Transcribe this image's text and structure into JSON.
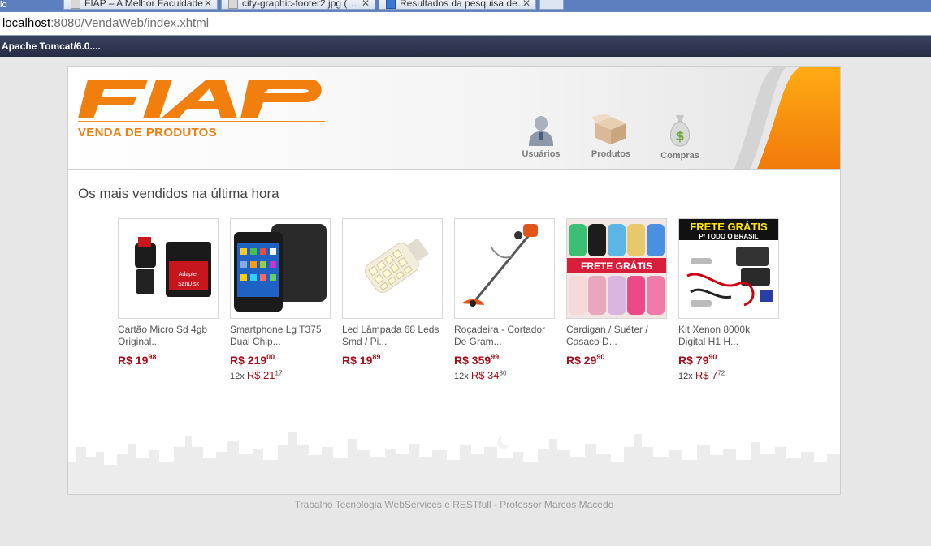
{
  "browser": {
    "tabs": [
      {
        "label": "FIAP – A Melhor Faculdade"
      },
      {
        "label": "city-graphic-footer2.jpg (…"
      },
      {
        "label": "Resultados da pesquisa de…"
      }
    ],
    "left_fragment": "lo",
    "url_host": "localhost",
    "url_rest": ":8080/VendaWeb/index.xhtml",
    "bookmark": "Apache Tomcat/6.0...."
  },
  "header": {
    "logo_text": "FIAP",
    "subtitle": "VENDA DE PRODUTOS",
    "brand_color": "#f07f0e",
    "nav": [
      {
        "label": "Usuários",
        "icon": "user-icon"
      },
      {
        "label": "Produtos",
        "icon": "box-icon"
      },
      {
        "label": "Compras",
        "icon": "money-bag-icon"
      }
    ]
  },
  "main": {
    "title": "Os mais vendidos na última hora",
    "products": [
      {
        "name": "Cartão Micro Sd 4gb Original...",
        "price_int": "R$ 19",
        "price_cents": "98",
        "inst_count": "",
        "inst_int": "",
        "inst_cents": "",
        "image": "sd-card-image"
      },
      {
        "name": "Smartphone Lg T375 Dual Chip...",
        "price_int": "R$ 219",
        "price_cents": "00",
        "inst_count": "12x",
        "inst_int": "R$ 21",
        "inst_cents": "17",
        "image": "smartphone-image"
      },
      {
        "name": "Led Lâmpada 68 Leds Smd / Pi...",
        "price_int": "R$ 19",
        "price_cents": "89",
        "inst_count": "",
        "inst_int": "",
        "inst_cents": "",
        "image": "led-lamp-image"
      },
      {
        "name": "Roçadeira - Cortador De Gram...",
        "price_int": "R$ 359",
        "price_cents": "99",
        "inst_count": "12x",
        "inst_int": "R$ 34",
        "inst_cents": "80",
        "image": "trimmer-image"
      },
      {
        "name": "Cardigan / Suéter / Casaco D...",
        "price_int": "R$ 29",
        "price_cents": "90",
        "inst_count": "",
        "inst_int": "",
        "inst_cents": "",
        "image": "cardigan-image",
        "badge": "FRETE GRÁTIS"
      },
      {
        "name": "Kit Xenon 8000k Digital H1 H...",
        "price_int": "R$ 79",
        "price_cents": "90",
        "inst_count": "12x",
        "inst_int": "R$ 7",
        "inst_cents": "72",
        "image": "xenon-kit-image",
        "badge_top": "FRETE GRÁTIS",
        "badge_sub": "P/ TODO O BRASIL"
      }
    ]
  },
  "footer": {
    "text": "Trabalho Tecnologia WebServices e RESTfull - Professor Marcos Macedo"
  }
}
